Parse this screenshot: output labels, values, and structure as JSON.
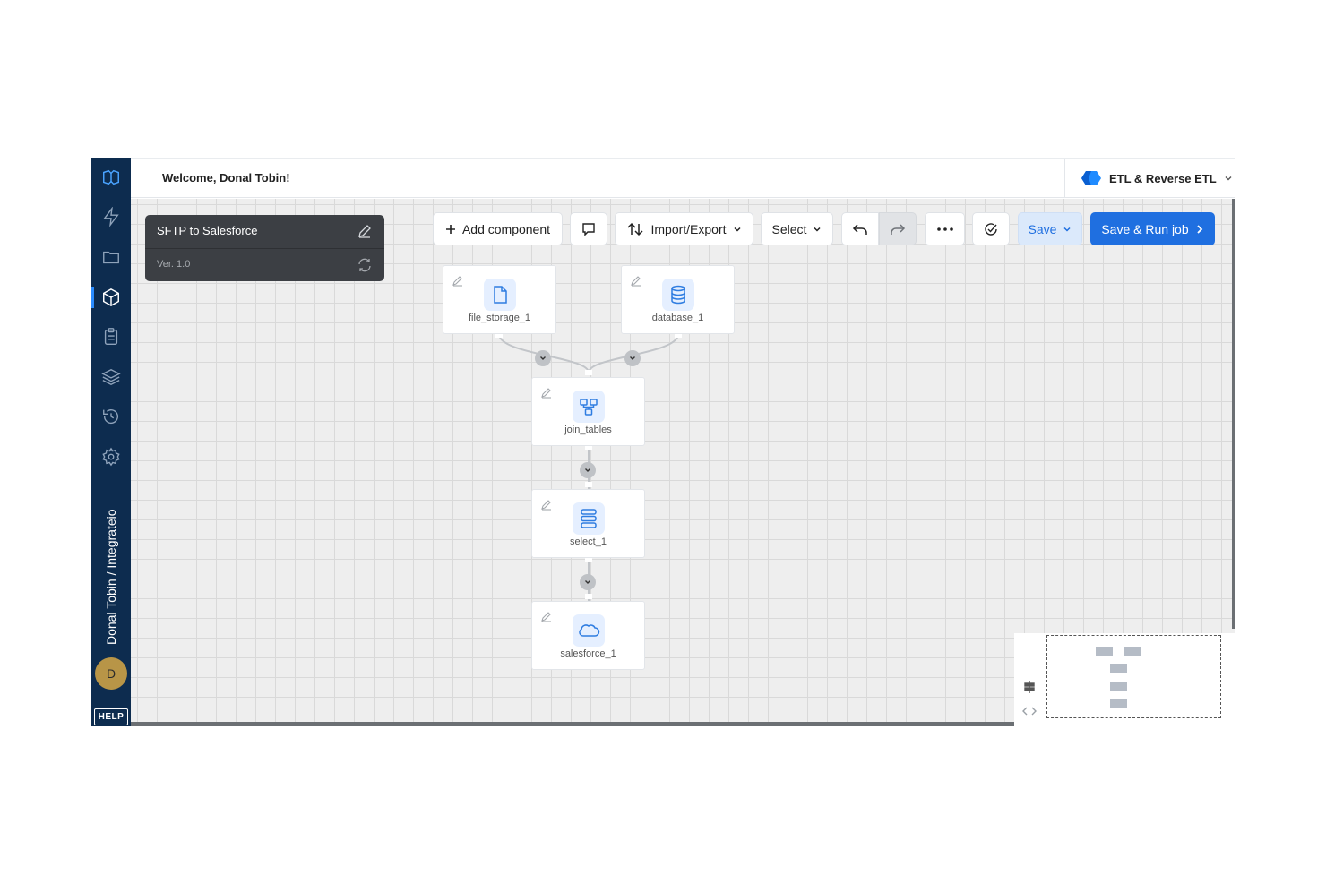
{
  "header": {
    "welcome": "Welcome, Donal Tobin!",
    "product": "ETL & Reverse ETL"
  },
  "sidebar": {
    "workspace": "Donal Tobin / Integrateio",
    "avatar_initial": "D",
    "help": "HELP",
    "items": [
      {
        "icon": "lightning-icon"
      },
      {
        "icon": "folder-icon"
      },
      {
        "icon": "package-icon",
        "active": true
      },
      {
        "icon": "clipboard-icon"
      },
      {
        "icon": "layers-icon"
      },
      {
        "icon": "history-icon"
      },
      {
        "icon": "gear-icon"
      }
    ]
  },
  "job": {
    "name": "SFTP to Salesforce",
    "version": "Ver. 1.0"
  },
  "toolbar": {
    "add_component": "Add component",
    "import_export": "Import/Export",
    "select": "Select",
    "save": "Save",
    "save_run": "Save & Run job"
  },
  "nodes": [
    {
      "id": "file_storage_1",
      "label": "file_storage_1",
      "icon": "file-icon"
    },
    {
      "id": "database_1",
      "label": "database_1",
      "icon": "database-icon"
    },
    {
      "id": "join_tables",
      "label": "join_tables",
      "icon": "join-icon"
    },
    {
      "id": "select_1",
      "label": "select_1",
      "icon": "select-icon"
    },
    {
      "id": "salesforce_1",
      "label": "salesforce_1",
      "icon": "cloud-icon"
    }
  ],
  "colors": {
    "sidebar_bg": "#0d2c4f",
    "accent": "#1f6fe0",
    "icon_blue": "#2f7de1",
    "canvas_bg": "#eeeeee",
    "panel_bg": "#3c3f44"
  }
}
